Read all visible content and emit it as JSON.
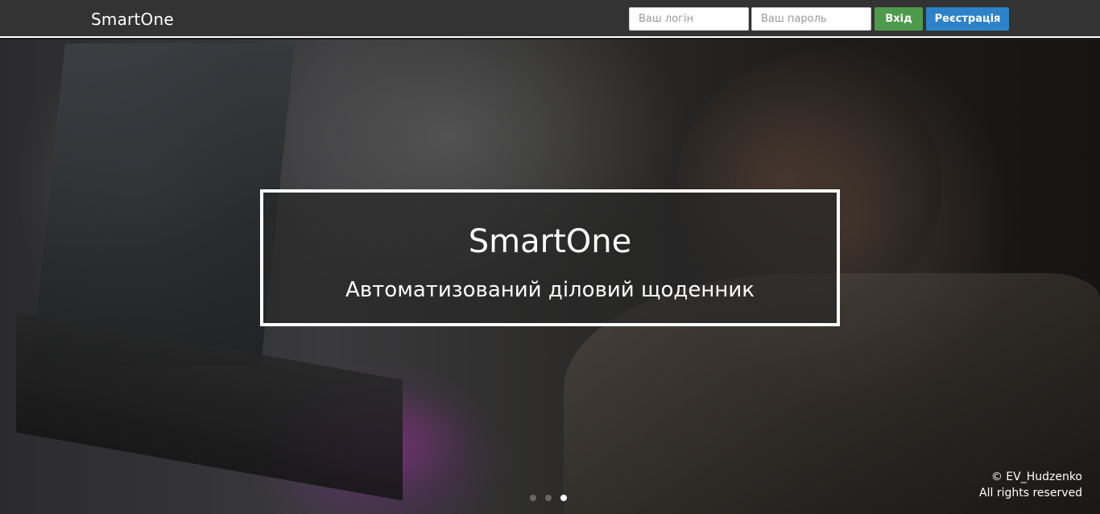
{
  "header": {
    "brand": "SmartOne",
    "login_placeholder": "Ваш логін",
    "password_placeholder": "Ваш пароль",
    "login_button": "Вхід",
    "register_button": "Реєстрація"
  },
  "hero": {
    "title": "SmartOne",
    "subtitle": "Автоматизований діловий щоденник",
    "slides": 3,
    "active_slide": 3
  },
  "footer": {
    "copyright": "© EV_Hudzenko",
    "rights": "All rights reserved"
  },
  "colors": {
    "navbar": "#333333",
    "login_button": "#4e9a4b",
    "register_button": "#2d82c9"
  }
}
